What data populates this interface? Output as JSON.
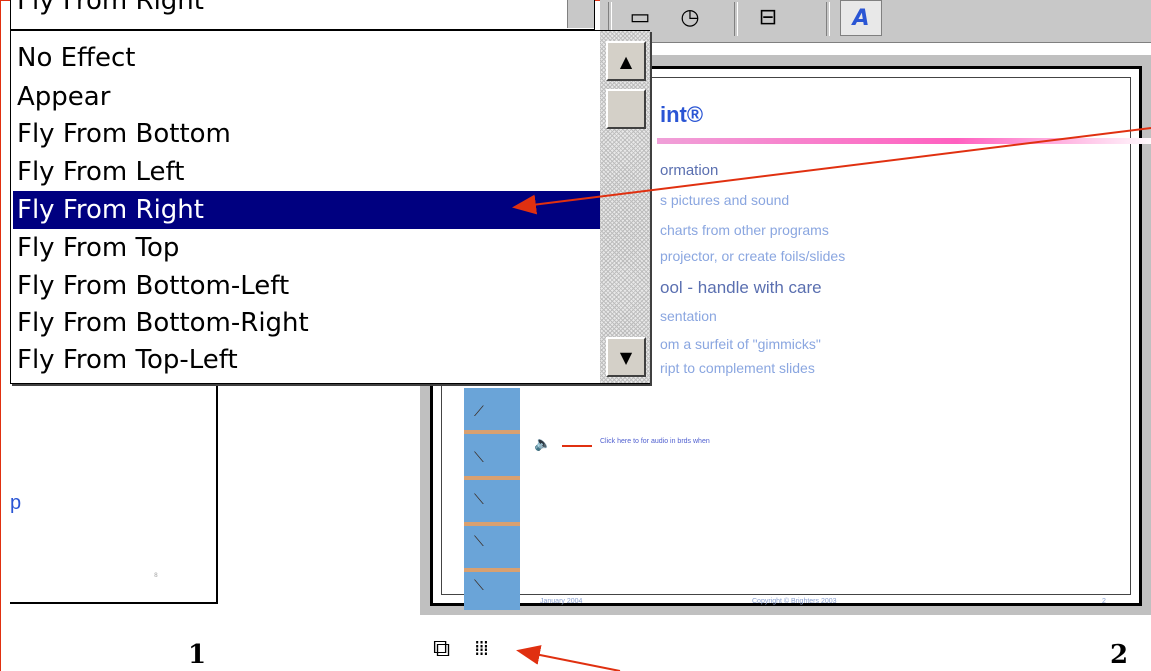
{
  "combo": {
    "value": "Fly From Right"
  },
  "effects": {
    "items": [
      "No Effect",
      "Appear",
      "Fly From Bottom",
      "Fly From Left",
      "Fly From Right",
      "Fly From Top",
      "Fly From Bottom-Left",
      "Fly From Bottom-Right",
      "Fly From Top-Left"
    ],
    "selected": "Fly From Right"
  },
  "slide": {
    "title": "int®",
    "bullets": [
      "ormation",
      "s pictures and sound",
      "charts from other programs",
      "projector, or create foils/slides",
      "ool - handle with care",
      "sentation",
      "om a surfeit of \"gimmicks\"",
      "ript to complement slides"
    ],
    "sound_caption": "Click here to for audio in brds when",
    "footer_left": "January 2004",
    "footer_center": "Copyright © Brighters 2003",
    "footer_right": "2"
  },
  "left_thumb": {
    "letter": "p",
    "number": "8"
  },
  "slide_numbers": {
    "left": "1",
    "right": "2"
  },
  "colors": {
    "selection": "#000080",
    "annotation_arrow": "#e03010",
    "title_blue": "#2a55d4"
  },
  "icons": [
    "scrollbar-up-icon",
    "scrollbar-down-icon",
    "dropdown-icon",
    "slide-show-icon",
    "slide-sorter-icon",
    "speaker-icon"
  ]
}
